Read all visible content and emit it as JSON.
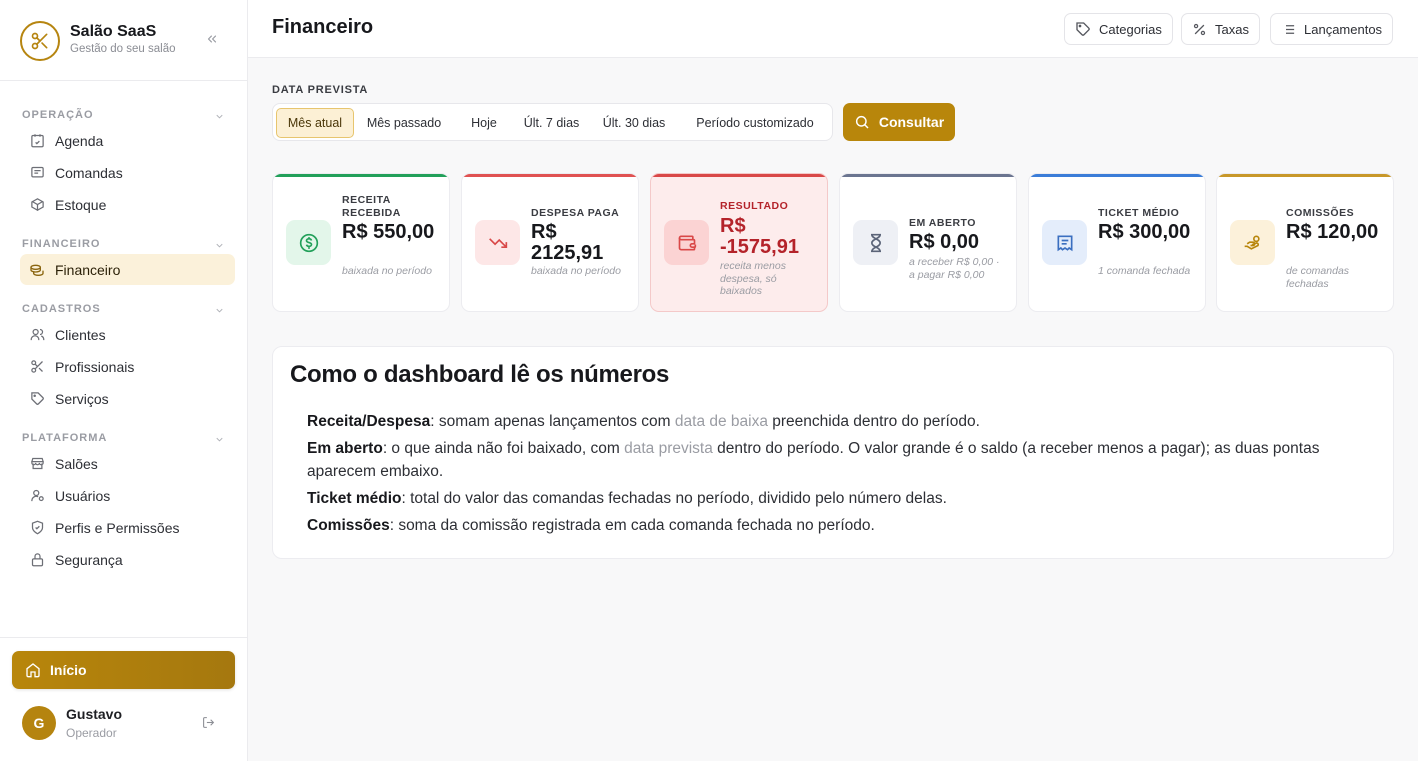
{
  "brand": {
    "name": "Salão SaaS",
    "subtitle": "Gestão do seu salão"
  },
  "sidebar": {
    "groups": [
      {
        "title": "OPERAÇÃO",
        "items": [
          {
            "label": "Agenda",
            "icon": "calendar-icon"
          },
          {
            "label": "Comandas",
            "icon": "receipt-icon"
          },
          {
            "label": "Estoque",
            "icon": "box-icon"
          }
        ]
      },
      {
        "title": "FINANCEIRO",
        "items": [
          {
            "label": "Financeiro",
            "icon": "coins-icon",
            "active": true
          }
        ]
      },
      {
        "title": "CADASTROS",
        "items": [
          {
            "label": "Clientes",
            "icon": "users-icon"
          },
          {
            "label": "Profissionais",
            "icon": "scissors-icon"
          },
          {
            "label": "Serviços",
            "icon": "tag-icon"
          }
        ]
      },
      {
        "title": "PLATAFORMA",
        "items": [
          {
            "label": "Salões",
            "icon": "store-icon"
          },
          {
            "label": "Usuários",
            "icon": "user-cog-icon"
          },
          {
            "label": "Perfis e Permissões",
            "icon": "shield-icon"
          },
          {
            "label": "Segurança",
            "icon": "lock-icon"
          }
        ]
      }
    ],
    "home_label": "Início",
    "user": {
      "initial": "G",
      "name": "Gustavo",
      "role": "Operador"
    }
  },
  "header": {
    "title": "Financeiro",
    "buttons": [
      {
        "label": "Categorias",
        "icon": "tag-icon"
      },
      {
        "label": "Taxas",
        "icon": "percent-icon"
      },
      {
        "label": "Lançamentos",
        "icon": "list-icon"
      }
    ]
  },
  "filters": {
    "label": "DATA PREVISTA",
    "periods": [
      "Mês atual",
      "Mês passado",
      "Hoje",
      "Últ. 7 dias",
      "Últ. 30 dias",
      "Período customizado"
    ],
    "selected": "Mês atual",
    "consult_label": "Consultar"
  },
  "cards": [
    {
      "label": "RECEITA RECEBIDA",
      "value": "R$ 550,00",
      "note": "baixada no período",
      "accent": "#22a05a",
      "icon": "dollar-circle-icon"
    },
    {
      "label": "DESPESA PAGA",
      "value": "R$ 2125,91",
      "note": "baixada no período",
      "accent": "#e05252",
      "icon": "trending-down-icon"
    },
    {
      "label": "RESULTADO",
      "value": "R$ -1575,91",
      "note": "receita menos despesa, só baixados",
      "accent": "#d94848",
      "icon": "wallet-icon"
    },
    {
      "label": "EM ABERTO",
      "value": "R$ 0,00",
      "note": "a receber R$ 0,00 · a pagar R$ 0,00",
      "accent": "#6b7590",
      "icon": "hourglass-icon"
    },
    {
      "label": "TICKET MÉDIO",
      "value": "R$ 300,00",
      "note": "1 comanda fechada",
      "accent": "#3b7dd8",
      "icon": "receipt-icon"
    },
    {
      "label": "COMISSÕES",
      "value": "R$ 120,00",
      "note": "de comandas fechadas",
      "accent": "#c8982a",
      "icon": "hand-coins-icon"
    }
  ],
  "explainer": {
    "title": "Como o dashboard lê os números",
    "lines": [
      {
        "term": "Receita/Despesa",
        "parts": [
          ": somam apenas lançamentos com ",
          "data de baixa",
          " preenchida dentro do período."
        ]
      },
      {
        "term": "Em aberto",
        "parts": [
          ": o que ainda não foi baixado, com ",
          "data prevista",
          " dentro do período. O valor grande é o saldo (a receber menos a pagar); as duas pontas aparecem embaixo."
        ]
      },
      {
        "term": "Ticket médio",
        "parts": [
          ": total do valor das comandas fechadas no período, dividido pelo número delas."
        ]
      },
      {
        "term": "Comissões",
        "parts": [
          ": soma da comissão registrada em cada comanda fechada no período."
        ]
      }
    ]
  }
}
